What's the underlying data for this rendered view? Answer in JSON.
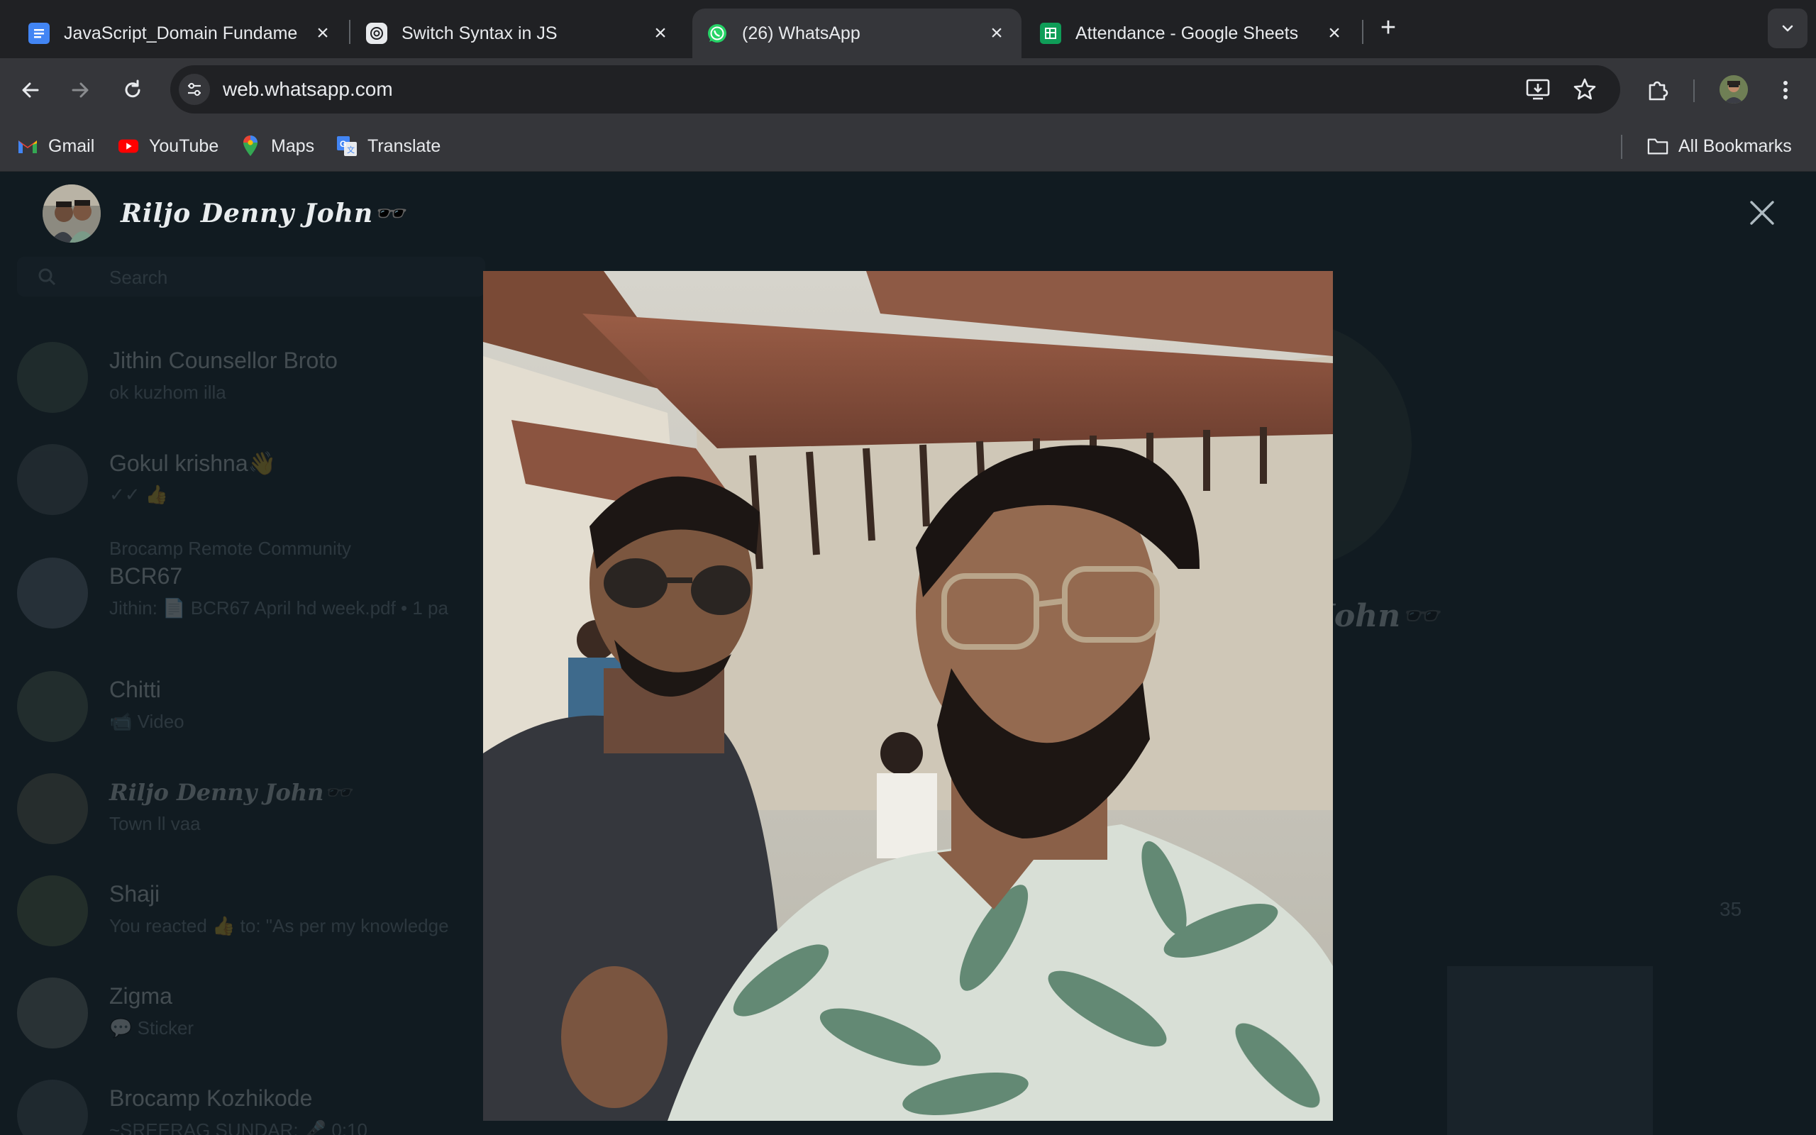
{
  "browser": {
    "tabs": [
      {
        "title": "JavaScript_Domain Fundame",
        "icon": "google-docs-icon",
        "active": false
      },
      {
        "title": "Switch Syntax in JS",
        "icon": "chatgpt-icon",
        "active": false
      },
      {
        "title": "(26) WhatsApp",
        "icon": "whatsapp-icon",
        "active": true
      },
      {
        "title": "Attendance - Google Sheets",
        "icon": "google-sheets-icon",
        "active": false
      }
    ],
    "url": "web.whatsapp.com",
    "bookmarks": [
      {
        "label": "Gmail",
        "icon": "gmail-icon"
      },
      {
        "label": "YouTube",
        "icon": "youtube-icon"
      },
      {
        "label": "Maps",
        "icon": "maps-icon"
      },
      {
        "label": "Translate",
        "icon": "translate-icon"
      }
    ],
    "all_bookmarks_label": "All Bookmarks"
  },
  "viewer": {
    "contact_name": "𝑹𝒊𝒍𝒋𝒐 𝑫𝒆𝒏𝒏𝒚 𝑱𝒐𝒉𝒏🕶️",
    "image_alt": "selfie"
  },
  "background": {
    "search_placeholder": "Search",
    "chats": [
      {
        "name": "Jithin Counsellor Broto",
        "message": "ok kuzhom illa"
      },
      {
        "name": "Gokul krishna👋",
        "message": "✓✓ 👍"
      },
      {
        "group": "Brocamp Remote Community",
        "name": "BCR67",
        "message": "Jithin: 📄 BCR67 April hd week.pdf • 1 pa"
      },
      {
        "name": "Chitti",
        "message": "📹 Video"
      },
      {
        "name": "𝑹𝒊𝒍𝒋𝒐 𝑫𝒆𝒏𝒏𝒚 𝑱𝒐𝒉𝒏🕶️",
        "message": "Town ll vaa"
      },
      {
        "name": "Shaji",
        "message": "You reacted 👍 to: \"As per my knowledge"
      },
      {
        "name": "Zigma",
        "message": "💬 Sticker"
      },
      {
        "name": "Brocamp Kozhikode",
        "message": "~SREERAG SUNDAR: 🎤 0:10"
      }
    ],
    "profile_name_fragment": "John🕶️",
    "media_count": "35"
  },
  "colors": {
    "chrome_frame": "#202124",
    "chrome_toolbar": "#35363a",
    "whatsapp_bg": "#111b21",
    "whatsapp_green": "#25d366"
  }
}
